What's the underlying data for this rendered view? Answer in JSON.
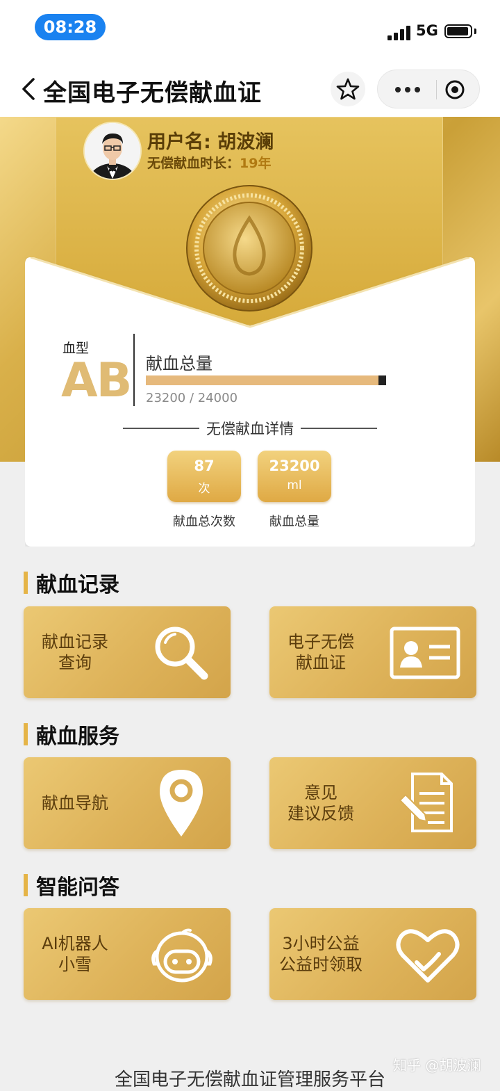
{
  "status_bar": {
    "time": "08:28",
    "network": "5G"
  },
  "nav": {
    "title": "全国电子无偿献血证"
  },
  "profile": {
    "username": "用户名: 胡波澜",
    "duration_label": "无偿献血时长：",
    "duration_value": "19年"
  },
  "card": {
    "blood_type_label": "血型",
    "blood_type": "AB",
    "total_label": "献血总量",
    "progress_text": "23200 / 24000",
    "progress_fraction": 0.967,
    "detail_title": "无偿献血详情",
    "stats": [
      {
        "value": "87",
        "unit": "次",
        "label": "献血总次数"
      },
      {
        "value": "23200",
        "unit": "ml",
        "label": "献血总量"
      }
    ]
  },
  "sections": [
    {
      "title": "献血记录",
      "tiles": [
        {
          "label": "献血记录\n查询",
          "icon": "search-icon"
        },
        {
          "label": "电子无偿\n献血证",
          "icon": "id-card-icon"
        }
      ]
    },
    {
      "title": "献血服务",
      "tiles": [
        {
          "label": "献血导航",
          "icon": "location-pin-icon"
        },
        {
          "label": "意见\n建议反馈",
          "icon": "feedback-document-icon"
        }
      ]
    },
    {
      "title": "智能问答",
      "tiles": [
        {
          "label": "AI机器人\n小雪",
          "icon": "robot-icon"
        },
        {
          "label": "3小时公益\n公益时领取",
          "icon": "heart-icon"
        }
      ]
    }
  ],
  "footer": {
    "text": "全国电子无偿献血证管理服务平台"
  },
  "watermark": "知乎 @胡波澜",
  "colors": {
    "gold": "#d9b04a",
    "tile_gold": "#deb35a",
    "accent_blue": "#1a82f0"
  }
}
